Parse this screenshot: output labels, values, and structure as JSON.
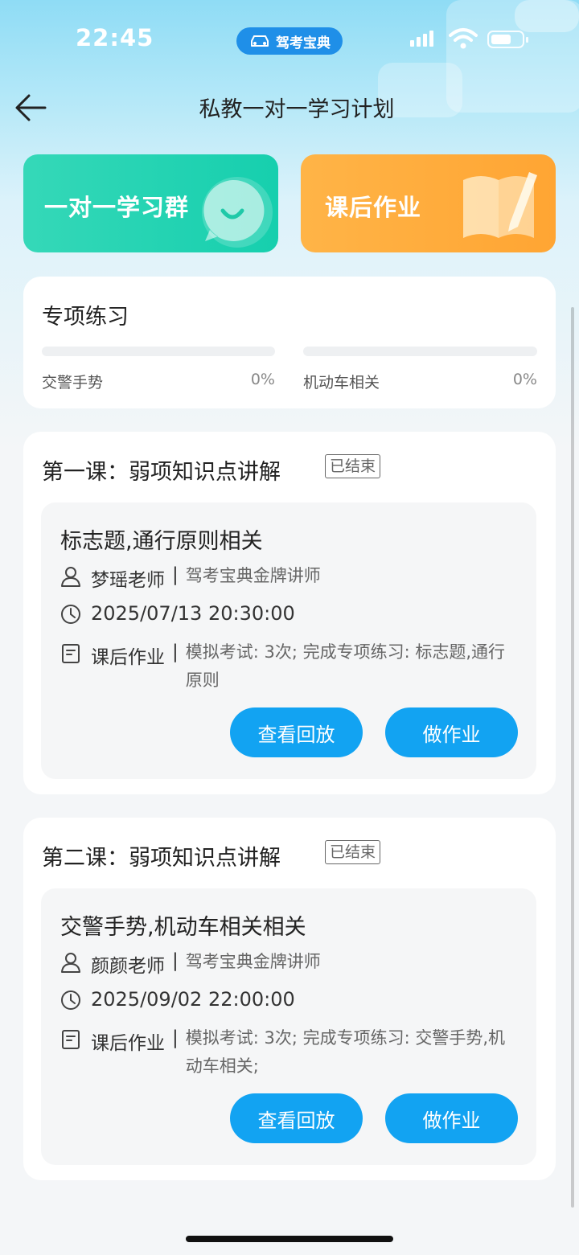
{
  "status_bar": {
    "time": "22:45",
    "app_badge": "驾考宝典"
  },
  "nav": {
    "title": "私教一对一学习计划"
  },
  "tiles": {
    "group_label": "一对一学习群",
    "homework_label": "课后作业"
  },
  "practice": {
    "title": "专项练习",
    "items": [
      {
        "label": "交警手势",
        "percent": "0%",
        "progress": 0
      },
      {
        "label": "机动车相关",
        "percent": "0%",
        "progress": 0
      }
    ]
  },
  "lessons": [
    {
      "title": "第一课：弱项知识点讲解",
      "status": "已结束",
      "topic": "标志题,通行原则相关",
      "teacher": "梦瑶老师",
      "teacher_title": "驾考宝典金牌讲师",
      "datetime": "2025/07/13 20:30:00",
      "homework_key": "课后作业",
      "homework_desc": "模拟考试: 3次; 完成专项练习: 标志题,通行原则",
      "replay_label": "查看回放",
      "do_homework_label": "做作业"
    },
    {
      "title": "第二课：弱项知识点讲解",
      "status": "已结束",
      "topic": "交警手势,机动车相关相关",
      "teacher": "颜颜老师",
      "teacher_title": "驾考宝典金牌讲师",
      "datetime": "2025/09/02 22:00:00",
      "homework_key": "课后作业",
      "homework_desc": "模拟考试: 3次; 完成专项练习: 交警手势,机动车相关;",
      "replay_label": "查看回放",
      "do_homework_label": "做作业"
    }
  ],
  "colors": {
    "accent_blue": "#12a3f2",
    "teal_tile": "#1fd3b2",
    "orange_tile": "#ffaa3a"
  }
}
